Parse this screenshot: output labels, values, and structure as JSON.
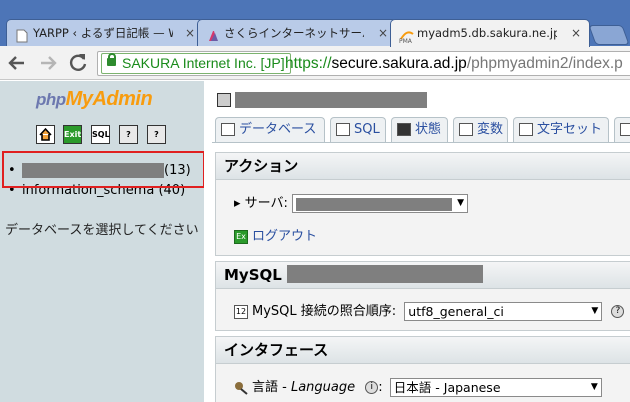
{
  "browser": {
    "tabs": [
      {
        "title": "YARPP ‹ よるず日記帳 — W",
        "icon": "page-icon",
        "active": false
      },
      {
        "title": "さくらインターネットサーバコント",
        "icon": "sakura-icon",
        "active": false
      },
      {
        "title": "myadm5.db.sakura.ne.jp",
        "icon": "phpmyadmin-favicon",
        "active": true
      }
    ],
    "close_glyph": "×",
    "ev_label": "SAKURA Internet Inc. [JP]",
    "url_scheme": "https://",
    "url_host": "secure.sakura.ad.jp",
    "url_path": "/phpmyadmin2/index.p"
  },
  "nav": {
    "logo_php": "php",
    "logo_my": "My",
    "logo_admin": "Admin",
    "icons": [
      "home-icon",
      "exit-icon",
      "sql-icon",
      "help-icon",
      "docs-icon"
    ],
    "databases": [
      {
        "name": "",
        "count": "(13)",
        "redacted": true
      },
      {
        "name": "information_schema",
        "count": "(40)",
        "redacted": false
      }
    ],
    "choose_text": "データベースを選択してください"
  },
  "main": {
    "tabs": [
      {
        "label": "データベース",
        "icon": "database-icon"
      },
      {
        "label": "SQL",
        "icon": "sql-icon"
      },
      {
        "label": "状態",
        "icon": "status-icon"
      },
      {
        "label": "変数",
        "icon": "variables-icon"
      },
      {
        "label": "文字セット",
        "icon": "charset-icon"
      }
    ],
    "actions": {
      "heading": "アクション",
      "server_label": "サーバ:",
      "logout_label": "ログアウト"
    },
    "mysql": {
      "heading": "MySQL",
      "collation_label": "MySQL 接続の照合順序:",
      "collation_value": "utf8_general_ci"
    },
    "interface": {
      "heading": "インタフェース",
      "language_label": "言語 - ",
      "language_label_en": "Language",
      "language_value": "日本語 - Japanese"
    }
  },
  "colors": {
    "tabstrip": "#4d75b7",
    "nav_bg": "#d0dce0",
    "ev_green": "#198b1a",
    "link_blue": "#2a4fa0",
    "highlight_red": "#e02020"
  }
}
